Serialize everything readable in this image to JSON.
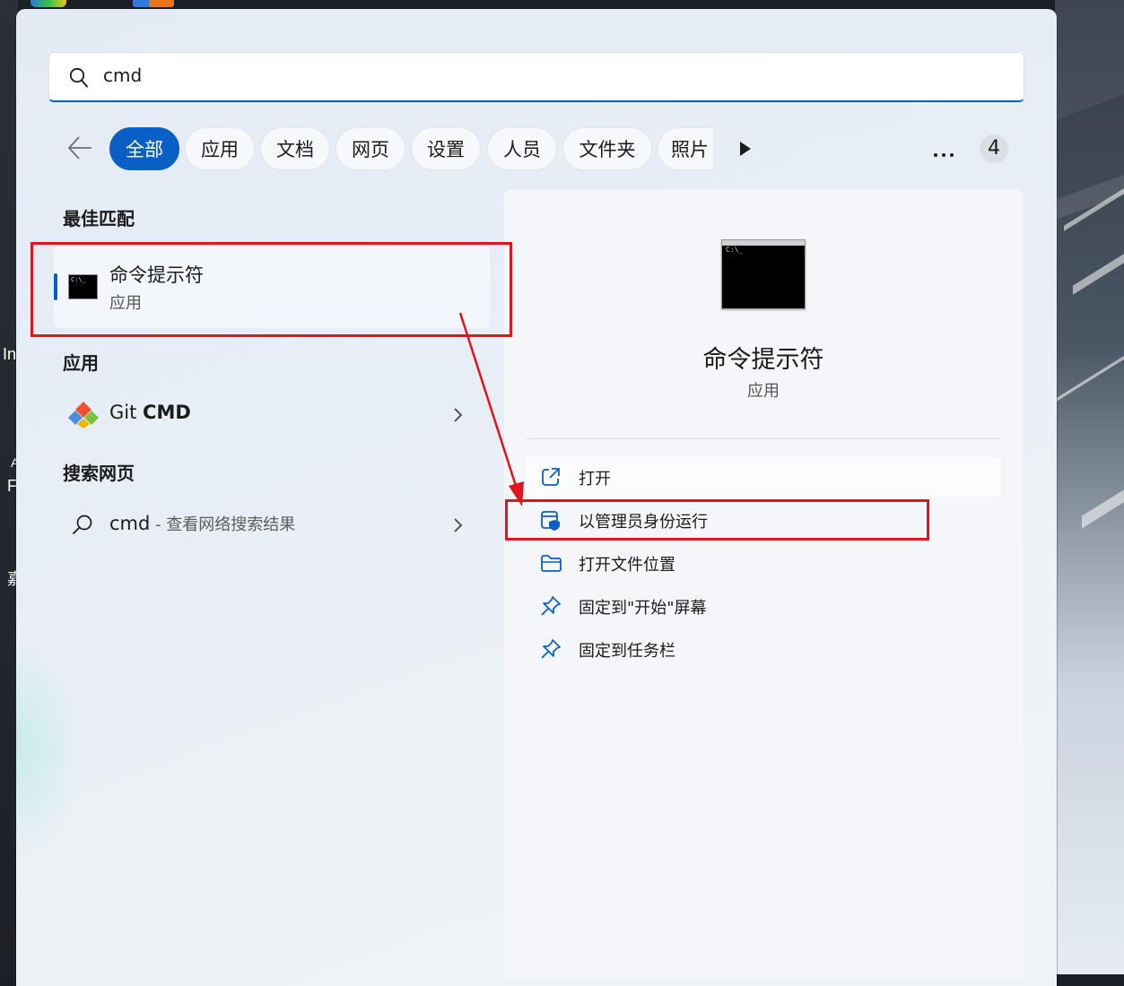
{
  "desktop": {
    "left_fragments": [
      "In",
      "A",
      "F",
      "嘉"
    ]
  },
  "search": {
    "query": "cmd"
  },
  "filters": {
    "chips": [
      "全部",
      "应用",
      "文档",
      "网页",
      "设置",
      "人员",
      "文件夹",
      "照片"
    ],
    "active": "全部",
    "count_badge": "4"
  },
  "best_match": {
    "heading": "最佳匹配",
    "title": "命令提示符",
    "subtitle": "应用"
  },
  "apps_section": {
    "heading": "应用",
    "items": [
      {
        "name_prefix": "Git ",
        "name_strong": "CMD"
      }
    ]
  },
  "web_section": {
    "heading": "搜索网页",
    "query": "cmd",
    "hint": " - 查看网络搜索结果"
  },
  "detail": {
    "app_title": "命令提示符",
    "app_type": "应用",
    "icon_prompt": "C:\\_",
    "actions": [
      {
        "label": "打开",
        "icon": "open-external-icon"
      },
      {
        "label": "以管理员身份运行",
        "icon": "admin-shield-icon"
      },
      {
        "label": "打开文件位置",
        "icon": "folder-icon"
      },
      {
        "label": "固定到\"开始\"屏幕",
        "icon": "pin-icon"
      },
      {
        "label": "固定到任务栏",
        "icon": "pin-icon"
      }
    ]
  },
  "colors": {
    "accent": "#0a5fc5",
    "annotation": "#e0161b"
  }
}
